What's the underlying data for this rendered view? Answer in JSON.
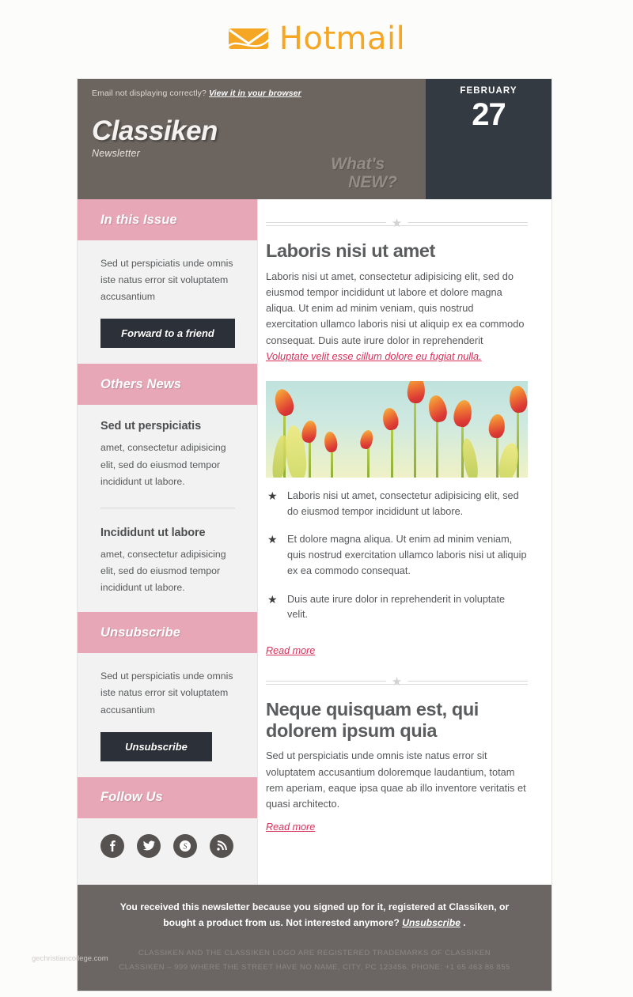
{
  "brand": {
    "name": "Hotmail",
    "logo_icon": "envelope-icon",
    "accent_color": "#f5a623"
  },
  "email": {
    "notice": {
      "text": "Email not displaying correctly?",
      "link": "View it in your browser"
    },
    "masthead": {
      "title": "Classiken",
      "subtitle": "Newsletter",
      "tagline_line1": "What's",
      "tagline_line2": "NEW?",
      "date_month": "FEBRUARY",
      "date_day": "27",
      "bg_color": "#6b645f",
      "date_bg_color": "#343a42"
    },
    "sidebar": {
      "header_color": "#e7a7b7",
      "sections": [
        {
          "heading": "In this Issue",
          "text": "Sed ut perspiciatis unde omnis iste natus error sit voluptatem accusantium",
          "button": "Forward to a friend"
        },
        {
          "heading": "Others News",
          "items": [
            {
              "title": "Sed ut perspiciatis",
              "text": "amet, consectetur adipisicing elit, sed do eiusmod tempor incididunt ut labore."
            },
            {
              "title": "Incididunt ut labore",
              "text": "amet, consectetur adipisicing elit, sed do eiusmod tempor incididunt ut labore."
            }
          ]
        },
        {
          "heading": "Unsubscribe",
          "text": "Sed ut perspiciatis unde omnis iste natus error sit voluptatem accusantium",
          "button": "Unsubscribe"
        },
        {
          "heading": "Follow Us",
          "social": [
            {
              "name": "facebook-icon",
              "glyph": "f"
            },
            {
              "name": "twitter-icon",
              "glyph": "t"
            },
            {
              "name": "skype-icon",
              "glyph": "S"
            },
            {
              "name": "rss-icon",
              "glyph": "r"
            }
          ]
        }
      ]
    },
    "articles": [
      {
        "title": "Laboris nisi ut amet",
        "body": "Laboris nisi ut amet, consectetur adipisicing elit, sed do eiusmod tempor incididunt ut labore et dolore magna aliqua. Ut enim ad minim veniam, quis nostrud exercitation ullamco laboris nisi ut aliquip ex ea commodo consequat. Duis aute irure dolor in reprehenderit ",
        "body_link": "Voluptate velit esse cillum dolore eu fugiat nulla.",
        "image_alt": "orange tulips against pale sky",
        "bullets": [
          "Laboris nisi ut amet, consectetur adipisicing elit, sed do eiusmod tempor incididunt ut labore.",
          "Et dolore magna aliqua. Ut enim ad minim veniam, quis nostrud exercitation ullamco laboris nisi ut aliquip ex ea commodo consequat.",
          "Duis aute irure dolor in reprehenderit in voluptate velit."
        ],
        "read_more": "Read more"
      },
      {
        "title": "Neque quisquam est, qui dolorem ipsum quia",
        "body": "Sed ut perspiciatis unde omnis iste natus error sit voluptatem accusantium doloremque laudantium, totam rem aperiam, eaque ipsa quae ab illo inventore veritatis et quasi architecto.",
        "read_more": "Read more"
      }
    ],
    "footer": {
      "main_text_before": "You received this newsletter because you signed up for it, registered at Classiken, or bought a product from us. Not interested anymore? ",
      "main_link": "Unsubscribe",
      "main_text_after": " .",
      "legal_line1": "CLASSIKEN AND THE CLASSIKEN LOGO ARE REGISTERED TRADEMARKS OF CLASSIKEN",
      "legal_line2": "CLASSIKEN – 999 WHERE THE STREET HAVE NO NAME, CITY, PC 123456. PHONE: +1 65 463 86 855",
      "bg_color": "#6b6663"
    },
    "link_color": "#d9305a"
  },
  "watermark": "gechristiancollege.com"
}
